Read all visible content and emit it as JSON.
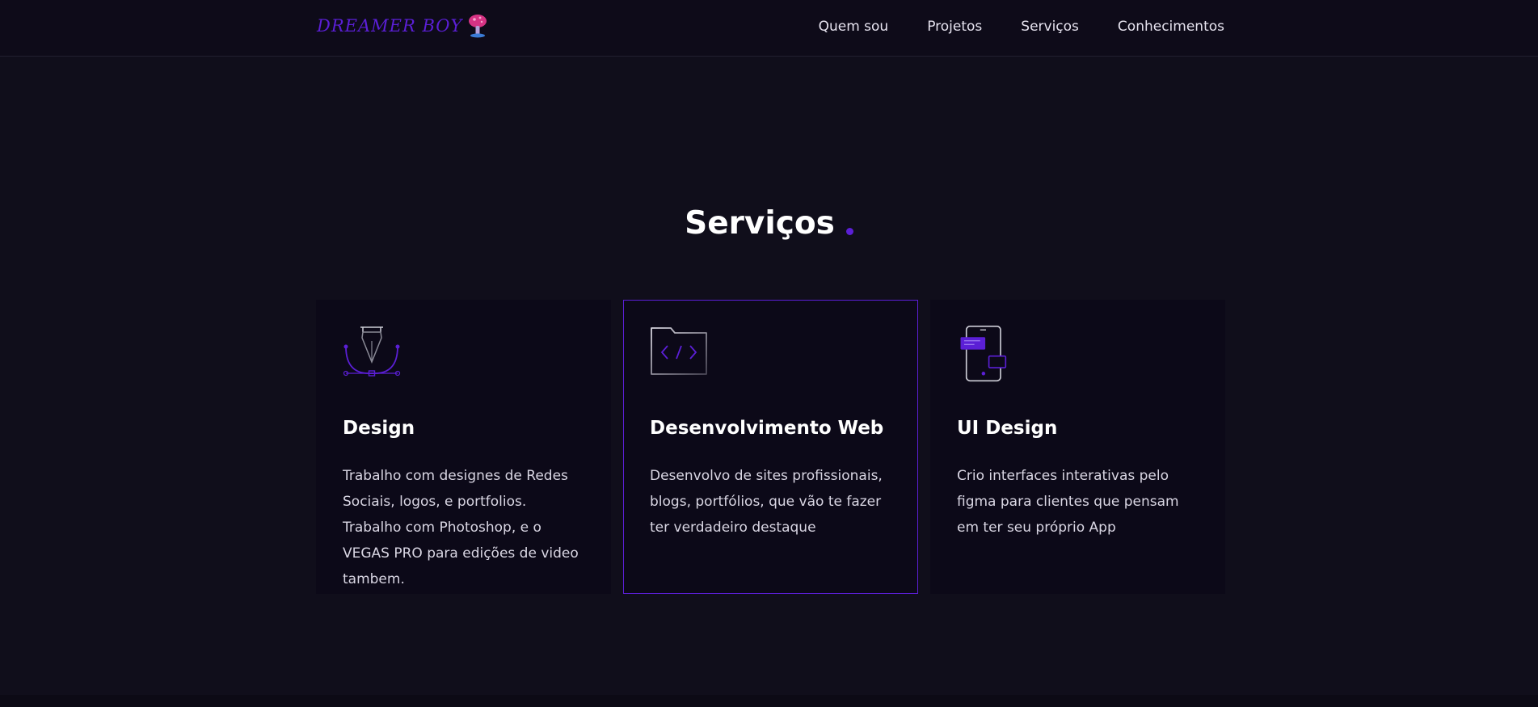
{
  "colors": {
    "accent": "#5b1fd6",
    "background": "#100e1b",
    "header_bg": "#0e0b19",
    "card_bg": "#0c0918",
    "text": "#ffffff",
    "muted_text": "#d9d6e3"
  },
  "header": {
    "logo_text": "DREAMER BOY",
    "logo_icon": "mushroom-icon",
    "nav": [
      {
        "label": "Quem sou"
      },
      {
        "label": "Projetos"
      },
      {
        "label": "Serviços"
      },
      {
        "label": "Conhecimentos"
      }
    ]
  },
  "services": {
    "title": "Serviços",
    "cards": [
      {
        "icon": "pen-tool-icon",
        "title": "Design",
        "description": "Trabalho com designes de Redes Sociais, logos, e portfolios. Trabalho com Photoshop, e o VEGAS PRO para edições de video tambem."
      },
      {
        "icon": "code-folder-icon",
        "title": "Desenvolvimento Web",
        "description": "Desenvolvo de sites profissionais, blogs, portfólios, que vão te fazer ter verdadeiro destaque"
      },
      {
        "icon": "mobile-app-icon",
        "title": "UI Design",
        "description": "Crio interfaces interativas pelo figma para clientes que pensam em ter seu próprio App"
      }
    ]
  }
}
